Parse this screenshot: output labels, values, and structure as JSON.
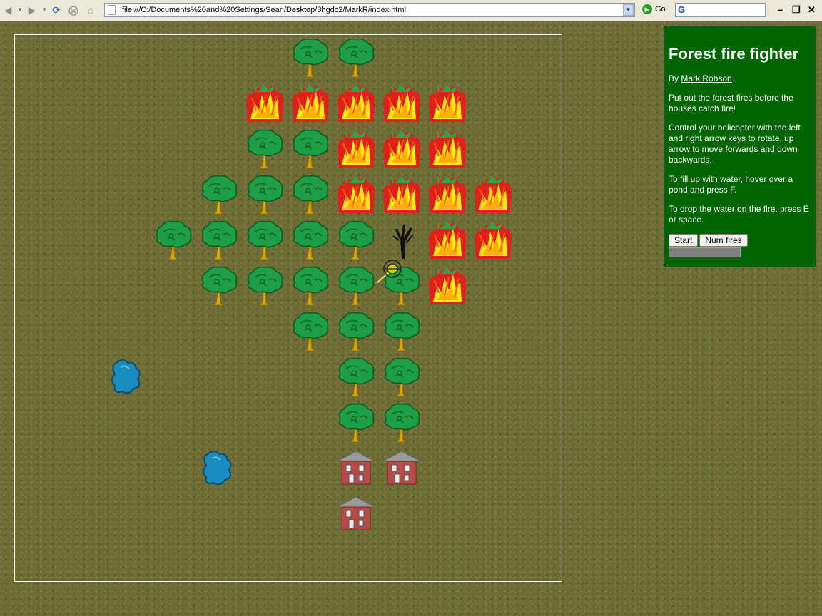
{
  "browser": {
    "url": "file:///C:/Documents%20and%20Settings/Sean/Desktop/3hgdc2/MarkR/index.html",
    "go_label": "Go",
    "search_value": ""
  },
  "game": {
    "trees": [
      [
        6,
        0
      ],
      [
        7,
        0
      ],
      [
        5,
        2
      ],
      [
        6,
        2
      ],
      [
        4,
        3
      ],
      [
        5,
        3
      ],
      [
        6,
        3
      ],
      [
        3,
        4
      ],
      [
        4,
        4
      ],
      [
        5,
        4
      ],
      [
        6,
        4
      ],
      [
        7,
        4
      ],
      [
        4,
        5
      ],
      [
        5,
        5
      ],
      [
        6,
        5
      ],
      [
        7,
        5
      ],
      [
        8,
        5
      ],
      [
        6,
        6
      ],
      [
        7,
        6
      ],
      [
        8,
        6
      ],
      [
        7,
        7
      ],
      [
        8,
        7
      ],
      [
        7,
        8
      ],
      [
        8,
        8
      ]
    ],
    "fires": [
      [
        5,
        1
      ],
      [
        6,
        1
      ],
      [
        7,
        1
      ],
      [
        8,
        1
      ],
      [
        9,
        1
      ],
      [
        7,
        2
      ],
      [
        8,
        2
      ],
      [
        9,
        2
      ],
      [
        7,
        3
      ],
      [
        8,
        3
      ],
      [
        9,
        3
      ],
      [
        10,
        3
      ],
      [
        9,
        4
      ],
      [
        10,
        4
      ],
      [
        9,
        5
      ]
    ],
    "burnt_trees": [
      [
        8,
        4
      ]
    ],
    "houses": [
      [
        7,
        9
      ],
      [
        8,
        9
      ],
      [
        7,
        10
      ]
    ],
    "ponds": [
      [
        2,
        7
      ],
      [
        4,
        9
      ]
    ],
    "helicopter": {
      "col": 8,
      "row": 4.6
    }
  },
  "panel": {
    "title": "Forest fire fighter",
    "author_prefix": "By ",
    "author_name": "Mark Robson",
    "paragraphs": [
      "Put out the forest fires before the houses catch fire!",
      "Control your helicopter with the left and right arrow keys to rotate, up arrow to move forwards and down backwards.",
      "To fill up with water, hover over a pond and press F.",
      "To drop the water on the fire, press E or space."
    ],
    "start_label": "Start",
    "numfires_label": "Num fires",
    "water_level": 0
  },
  "colors": {
    "panel_bg": "#006400",
    "tree_canopy": "#1e9e46",
    "fire_red": "#e0201a",
    "fire_yellow": "#ffe81a",
    "pond": "#1a8cc0",
    "house_wall": "#b84a48"
  }
}
